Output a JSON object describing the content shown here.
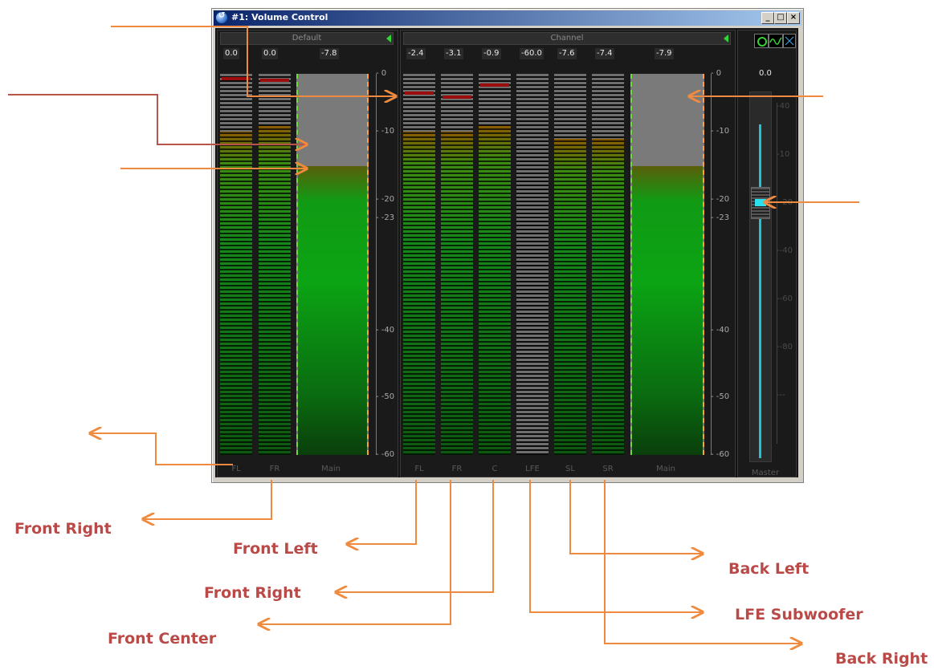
{
  "window": {
    "title": "#1: Volume Control",
    "controls": [
      "_",
      "□",
      "×"
    ]
  },
  "panels": {
    "default": {
      "header": "Default",
      "values": [
        "0.0",
        "0.0",
        "-7.8"
      ],
      "channels": [
        "FL",
        "FR",
        "Main"
      ],
      "levels_db": [
        -10,
        -9,
        -15
      ],
      "peaks_db": [
        -0.5,
        -0.8
      ]
    },
    "channel": {
      "header": "Channel",
      "values": [
        "-2.4",
        "-3.1",
        "-0.9",
        "-60.0",
        "-7.6",
        "-7.4",
        "-7.9"
      ],
      "channels": [
        "FL",
        "FR",
        "C",
        "LFE",
        "SL",
        "SR",
        "Main"
      ],
      "levels_db": [
        -10,
        -10,
        -9,
        -60,
        -11,
        -11,
        -15
      ],
      "peaks_db": [
        -3,
        -3.8,
        -1.6
      ],
      "scale_ticks": [
        "0",
        "-10",
        "-20",
        "-23",
        "-40",
        "-50",
        "-60"
      ]
    },
    "default_scale_ticks": [
      "0",
      "-10",
      "-20",
      "-23",
      "-40",
      "-50",
      "-60"
    ],
    "master": {
      "value": "0.0",
      "label": "Master",
      "scale_ticks": [
        "40",
        "10",
        "-20",
        "-40",
        "-60",
        "-80",
        "--"
      ]
    }
  },
  "mini_icons": [
    "power-icon",
    "waveform-icon",
    "grid-icon"
  ],
  "annotations": {
    "labels": [
      "Front Right",
      "Front Left",
      "Front Right",
      "Front Center",
      "Back Left",
      "LFE Subwoofer",
      "Back Right"
    ]
  },
  "colors": {
    "arrow": "#f08a3e",
    "label": "#b94a48",
    "meter_green": "#0ba414",
    "master_cyan": "#28e0ee"
  }
}
